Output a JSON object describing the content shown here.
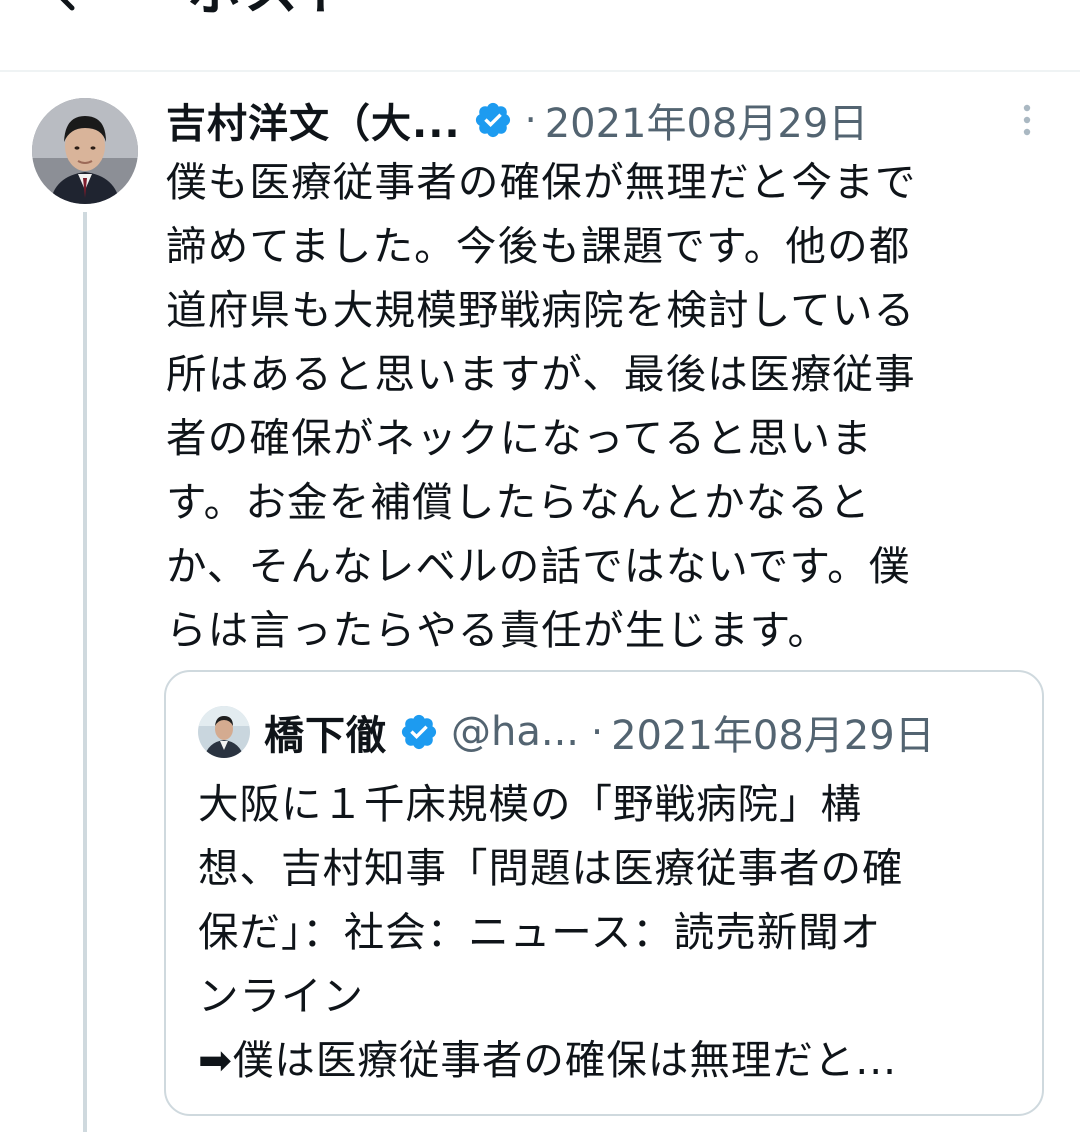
{
  "header": {
    "title": "ポスト",
    "back_icon": "arrow-left-icon"
  },
  "tweet": {
    "author_name": "吉村洋文（大...",
    "separator": "·",
    "date": "2021年08月29日",
    "body": "僕も医療従事者の確保が無理だと今まで\n諦めてました。今後も課題です。他の都\n道府県も大規模野戦病院を検討している\n所はあると思いますが、最後は医療従事\n者の確保がネックになってると思いま\nす。お金を補償したらなんとかなると\nか、そんなレベルの話ではないです。僕\nらは言ったらやる責任が生じます。"
  },
  "quote": {
    "author_name": "橋下徹",
    "handle": "@ha...",
    "separator": "·",
    "date": "2021年08月29日",
    "body": "大阪に１千床規模の「野戦病院」構\n想、吉村知事「問題は医療従事者の確\n保だ」：社会：ニュース：読売新聞オ\nンライン\n➡僕は医療従事者の確保は無理だと..."
  },
  "colors": {
    "verified": "#1d9bf0",
    "muted": "#536471",
    "border": "#cfd9de"
  }
}
